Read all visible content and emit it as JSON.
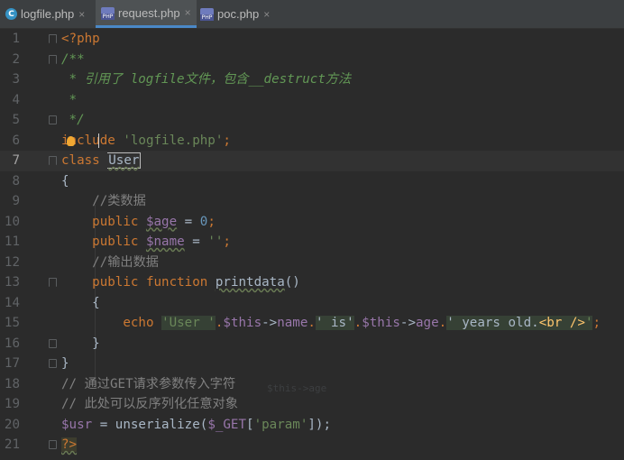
{
  "tabs": [
    {
      "label": "logfile.php",
      "icon": "c-file-icon",
      "icon_text": "C",
      "active": false
    },
    {
      "label": "request.php",
      "icon": "php-file-icon",
      "icon_text": "",
      "active": true
    },
    {
      "label": "poc.php",
      "icon": "php-file-icon",
      "icon_text": "",
      "active": false
    }
  ],
  "tab_close_glyph": "×",
  "line_numbers": [
    "1",
    "2",
    "3",
    "4",
    "5",
    "6",
    "7",
    "8",
    "9",
    "10",
    "11",
    "12",
    "13",
    "14",
    "15",
    "16",
    "17",
    "18",
    "19",
    "20",
    "21"
  ],
  "code": {
    "l1": {
      "t1": "<?php"
    },
    "l2": {
      "t1": "/**"
    },
    "l3": {
      "t1": " * 引用了 logfile文件，包含__destruct方法"
    },
    "l4": {
      "t1": " *"
    },
    "l5": {
      "t1": " */"
    },
    "l6": {
      "t1": "include",
      "t2": " ",
      "t3": "'logfile.php'",
      "t4": ";"
    },
    "l7": {
      "t1": "class",
      "t2": " ",
      "t3": "User"
    },
    "l8": {
      "t1": "{"
    },
    "l9": {
      "t1": "    //类数据"
    },
    "l10": {
      "t1": "    ",
      "t2": "public",
      "t3": " ",
      "t4": "$age",
      "t5": " = ",
      "t6": "0",
      "t7": ";"
    },
    "l11": {
      "t1": "    ",
      "t2": "public",
      "t3": " ",
      "t4": "$name",
      "t5": " = ",
      "t6": "''",
      "t7": ";"
    },
    "l12": {
      "t1": "    //输出数据"
    },
    "l13": {
      "t1": "    ",
      "t2": "public",
      "t3": " ",
      "t4": "function",
      "t5": " ",
      "t6": "printdata",
      "t7": "()"
    },
    "l14": {
      "t1": "    {"
    },
    "l15": {
      "t1": "        ",
      "t2": "echo",
      "t3": " ",
      "t4": "'User '",
      "t5": ".",
      "t6": "$this",
      "t7": "->",
      "t8": "name",
      "t9": ".",
      "t10": "' is'",
      "t11": ".",
      "t12": "$this",
      "t13": "->",
      "t14": "age",
      "t15": ".",
      "t16": "' years old.",
      "t17": "<br />",
      "t18": "'",
      "t19": ";"
    },
    "l16": {
      "t1": "    }"
    },
    "l17": {
      "t1": "}"
    },
    "l18": {
      "t1": "// 通过GET请求参数传入字符"
    },
    "l19": {
      "t1": "// 此处可以反序列化任意对象"
    },
    "l20": {
      "t1": "$usr",
      "t2": " = ",
      "t3": "unserialize",
      "t4": "(",
      "t5": "$_GET",
      "t6": "[",
      "t7": "'param'",
      "t8": "]);"
    },
    "l21": {
      "t1": "?>"
    }
  },
  "ghost_text": "$this->age",
  "colors": {
    "background": "#2b2b2b",
    "keyword": "#cc7832",
    "variable": "#9876aa",
    "string": "#6a8759",
    "number": "#6897bb",
    "comment": "#808080",
    "doc_comment": "#629755",
    "tab_accent": "#4a88c7"
  }
}
